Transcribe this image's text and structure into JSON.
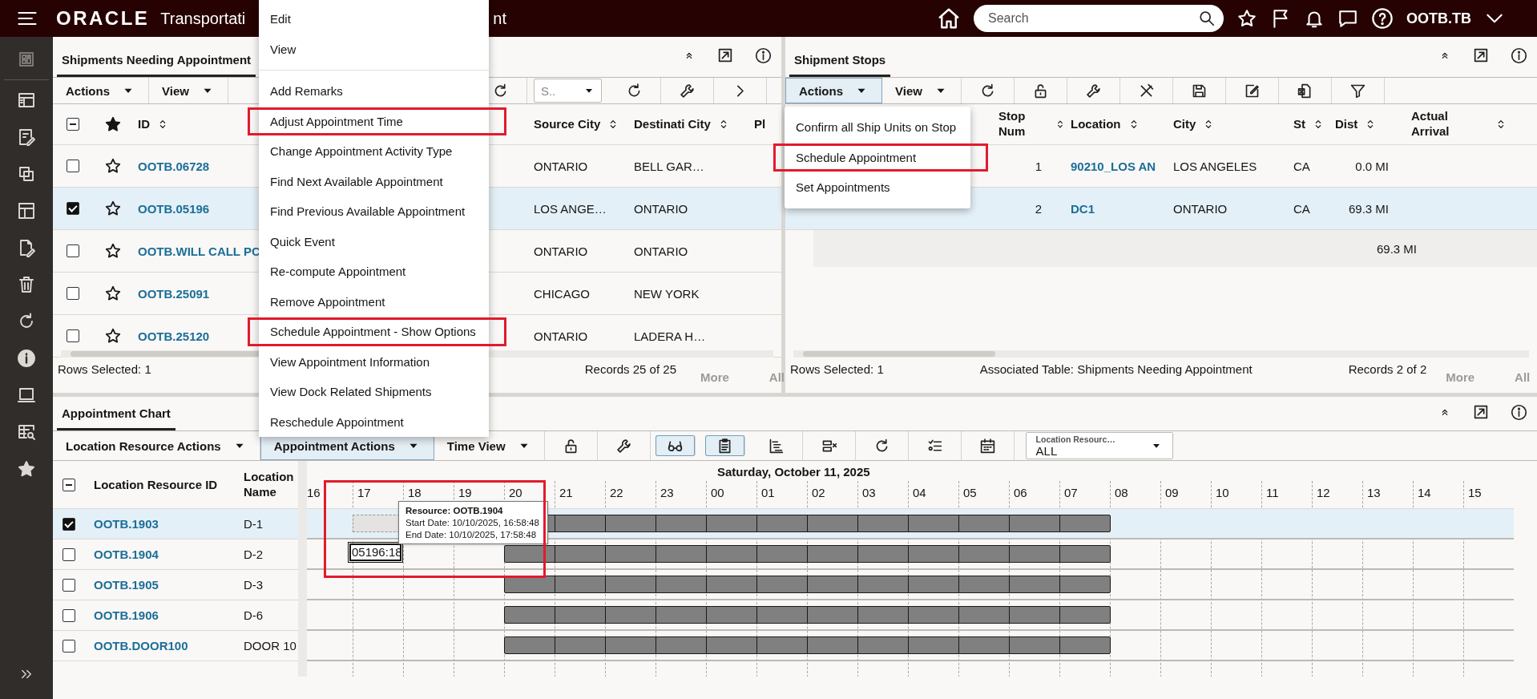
{
  "top_bar": {
    "logo": "ORACLE",
    "title": "Transportati",
    "title_tail": "nt",
    "search": {
      "placeholder": "Search"
    },
    "user": "OOTB.TB"
  },
  "shipments": {
    "title": "Shipments Needing Appointment",
    "toolbar": {
      "actions": {
        "label": "Actions",
        "open": false
      },
      "view": "View",
      "tools": [
        {
          "kind": "refresh"
        }
      ],
      "select": {
        "placeholder": "S.."
      },
      "tools_end": [
        {
          "kind": "reload"
        },
        {
          "kind": "wrench"
        },
        {
          "kind": "more"
        }
      ]
    },
    "select_all_partial": true,
    "columns": [
      {
        "label": "ID",
        "sort_icon": true
      },
      {
        "label": "Source City",
        "sort_icon": true
      },
      {
        "label": "Destinati City",
        "sort_icon": true
      },
      {
        "label": "Pl",
        "sort_icon": false
      }
    ],
    "rows": [
      {
        "id": "OOTB.06728",
        "source_city": "ONTARIO",
        "destination_city": "BELL GAR…",
        "checked": false,
        "selected": false
      },
      {
        "id": "OOTB.05196",
        "source_city": "LOS ANGE…",
        "destination_city": "ONTARIO",
        "checked": true,
        "selected": true
      },
      {
        "id": "OOTB.WILL CALL PC",
        "source_city": "ONTARIO",
        "destination_city": "ONTARIO",
        "checked": false,
        "selected": false
      },
      {
        "id": "OOTB.25091",
        "source_city": "CHICAGO",
        "destination_city": "NEW YORK",
        "checked": false,
        "selected": false
      },
      {
        "id": "OOTB.25120",
        "source_city": "ONTARIO",
        "destination_city": "LADERA H…",
        "checked": false,
        "selected": false
      }
    ],
    "rows_selected": "Rows Selected: 1",
    "records": "Records 25 of 25",
    "more": {
      "label": "More",
      "disabled": true
    },
    "all": {
      "label": "All",
      "disabled": true
    }
  },
  "stops": {
    "title": "Shipment Stops",
    "toolbar": {
      "actions": {
        "label": "Actions",
        "open": true
      },
      "view": "View",
      "tools": [
        {
          "kind": "refresh"
        },
        {
          "kind": "unlock"
        },
        {
          "kind": "wrench"
        },
        {
          "kind": "tools-cross"
        },
        {
          "kind": "save"
        },
        {
          "kind": "edit"
        },
        {
          "kind": "export"
        },
        {
          "kind": "filter"
        }
      ]
    },
    "columns": [
      {
        "label": "Stop Num",
        "sort_icon": true
      },
      {
        "label": "Location",
        "sort_icon": true
      },
      {
        "label": "City",
        "sort_icon": true
      },
      {
        "label": "St",
        "sort_icon": true
      },
      {
        "label": "Dist",
        "sort_icon": true
      },
      {
        "label": "Actual Arrival",
        "sort_icon": true
      }
    ],
    "rows": [
      {
        "stop_num": "1",
        "location": "90210_LOS AN",
        "city": "LOS ANGELES",
        "state": "CA",
        "dist": "0.0 MI",
        "selected": false
      },
      {
        "stop_num": "2",
        "location": "DC1",
        "city": "ONTARIO",
        "state": "CA",
        "dist": "69.3 MI",
        "selected": true
      }
    ],
    "total_dist": "69.3 MI",
    "rows_selected": "Rows Selected: 1",
    "associated": "Associated Table: Shipments Needing Appointment",
    "records": "Records 2 of 2",
    "more": {
      "label": "More",
      "disabled": true
    },
    "all": {
      "label": "All",
      "disabled": true
    }
  },
  "chart": {
    "title": "Appointment Chart",
    "toolbar": {
      "resource_actions": "Location Resource Actions",
      "appointment_actions": {
        "label": "Appointment Actions",
        "open": true
      },
      "time_view": "Time View",
      "tools": [
        {
          "kind": "unlock",
          "pressed": false
        },
        {
          "kind": "wrench",
          "pressed": false
        },
        {
          "kind": "glasses",
          "pressed": true
        },
        {
          "kind": "details",
          "pressed": true
        },
        {
          "kind": "gantt",
          "pressed": false
        },
        {
          "kind": "remove-column",
          "pressed": false
        },
        {
          "kind": "refresh",
          "pressed": false
        },
        {
          "kind": "list",
          "pressed": false
        },
        {
          "kind": "calendar",
          "pressed": false
        }
      ],
      "filter": {
        "label": "Location Resourc…",
        "value": "ALL"
      }
    },
    "select_all_partial": true,
    "columns": [
      "Location Resource ID",
      "Location Name"
    ],
    "hours": [
      {
        "label": "16"
      },
      {
        "label": "17"
      },
      {
        "label": "18"
      },
      {
        "label": "19"
      },
      {
        "label": "20"
      },
      {
        "label": "21"
      },
      {
        "label": "22"
      },
      {
        "label": "23"
      },
      {
        "label": "00",
        "date": "Saturday, October 11, 2025"
      },
      {
        "label": "01"
      },
      {
        "label": "02"
      },
      {
        "label": "03"
      },
      {
        "label": "04"
      },
      {
        "label": "05"
      },
      {
        "label": "06"
      },
      {
        "label": "07"
      },
      {
        "label": "08"
      },
      {
        "label": "09"
      },
      {
        "label": "10"
      },
      {
        "label": "11"
      },
      {
        "label": "12"
      },
      {
        "label": "13"
      },
      {
        "label": "14"
      },
      {
        "label": "15"
      }
    ],
    "rows": [
      {
        "id": "OOTB.1903",
        "name": "D-1",
        "checked": true,
        "selected": true,
        "slots": [
          {
            "kind": "none"
          },
          {
            "kind": "ghost"
          },
          {
            "kind": "none"
          },
          {
            "kind": "none"
          },
          {
            "kind": "bar"
          },
          {
            "kind": "bar"
          },
          {
            "kind": "bar"
          },
          {
            "kind": "bar"
          },
          {
            "kind": "bar"
          },
          {
            "kind": "bar"
          },
          {
            "kind": "bar"
          },
          {
            "kind": "bar"
          },
          {
            "kind": "bar"
          },
          {
            "kind": "bar"
          },
          {
            "kind": "bar"
          },
          {
            "kind": "bar"
          },
          {
            "kind": "none"
          },
          {
            "kind": "none"
          },
          {
            "kind": "none"
          },
          {
            "kind": "none"
          },
          {
            "kind": "none"
          },
          {
            "kind": "none"
          },
          {
            "kind": "none"
          },
          {
            "kind": "none"
          }
        ]
      },
      {
        "id": "OOTB.1904",
        "name": "D-2",
        "checked": false,
        "selected": false,
        "slots": [
          {
            "kind": "none"
          },
          {
            "kind": "dragged",
            "label": "05196:18"
          },
          {
            "kind": "none"
          },
          {
            "kind": "none"
          },
          {
            "kind": "bar"
          },
          {
            "kind": "bar"
          },
          {
            "kind": "bar"
          },
          {
            "kind": "bar"
          },
          {
            "kind": "bar"
          },
          {
            "kind": "bar"
          },
          {
            "kind": "bar"
          },
          {
            "kind": "bar"
          },
          {
            "kind": "bar"
          },
          {
            "kind": "bar"
          },
          {
            "kind": "bar"
          },
          {
            "kind": "bar"
          },
          {
            "kind": "none"
          },
          {
            "kind": "none"
          },
          {
            "kind": "none"
          },
          {
            "kind": "none"
          },
          {
            "kind": "none"
          },
          {
            "kind": "none"
          },
          {
            "kind": "none"
          },
          {
            "kind": "none"
          }
        ]
      },
      {
        "id": "OOTB.1905",
        "name": "D-3",
        "checked": false,
        "selected": false,
        "slots": [
          {
            "kind": "none"
          },
          {
            "kind": "none"
          },
          {
            "kind": "none"
          },
          {
            "kind": "none"
          },
          {
            "kind": "bar"
          },
          {
            "kind": "bar"
          },
          {
            "kind": "bar"
          },
          {
            "kind": "bar"
          },
          {
            "kind": "bar"
          },
          {
            "kind": "bar"
          },
          {
            "kind": "bar"
          },
          {
            "kind": "bar"
          },
          {
            "kind": "bar"
          },
          {
            "kind": "bar"
          },
          {
            "kind": "bar"
          },
          {
            "kind": "bar"
          },
          {
            "kind": "none"
          },
          {
            "kind": "none"
          },
          {
            "kind": "none"
          },
          {
            "kind": "none"
          },
          {
            "kind": "none"
          },
          {
            "kind": "none"
          },
          {
            "kind": "none"
          },
          {
            "kind": "none"
          }
        ]
      },
      {
        "id": "OOTB.1906",
        "name": "D-6",
        "checked": false,
        "selected": false,
        "slots": [
          {
            "kind": "none"
          },
          {
            "kind": "none"
          },
          {
            "kind": "none"
          },
          {
            "kind": "none"
          },
          {
            "kind": "bar"
          },
          {
            "kind": "bar"
          },
          {
            "kind": "bar"
          },
          {
            "kind": "bar"
          },
          {
            "kind": "bar"
          },
          {
            "kind": "bar"
          },
          {
            "kind": "bar"
          },
          {
            "kind": "bar"
          },
          {
            "kind": "bar"
          },
          {
            "kind": "bar"
          },
          {
            "kind": "bar"
          },
          {
            "kind": "bar"
          },
          {
            "kind": "none"
          },
          {
            "kind": "none"
          },
          {
            "kind": "none"
          },
          {
            "kind": "none"
          },
          {
            "kind": "none"
          },
          {
            "kind": "none"
          },
          {
            "kind": "none"
          },
          {
            "kind": "none"
          }
        ]
      },
      {
        "id": "OOTB.DOOR100",
        "name": "DOOR 10",
        "checked": false,
        "selected": false,
        "slots": [
          {
            "kind": "none"
          },
          {
            "kind": "none"
          },
          {
            "kind": "none"
          },
          {
            "kind": "none"
          },
          {
            "kind": "bar"
          },
          {
            "kind": "bar"
          },
          {
            "kind": "bar"
          },
          {
            "kind": "bar"
          },
          {
            "kind": "bar"
          },
          {
            "kind": "bar"
          },
          {
            "kind": "bar"
          },
          {
            "kind": "bar"
          },
          {
            "kind": "bar"
          },
          {
            "kind": "bar"
          },
          {
            "kind": "bar"
          },
          {
            "kind": "bar"
          },
          {
            "kind": "none"
          },
          {
            "kind": "none"
          },
          {
            "kind": "none"
          },
          {
            "kind": "none"
          },
          {
            "kind": "none"
          },
          {
            "kind": "none"
          },
          {
            "kind": "none"
          },
          {
            "kind": "none"
          }
        ]
      }
    ],
    "tooltip": {
      "title": "Resource: OOTB.1904",
      "start": "Start Date: 10/10/2025, 16:58:48",
      "end": "End Date: 10/10/2025, 17:58:48"
    },
    "highlighted": true
  },
  "appointment_menu": {
    "groups": [
      [
        {
          "label": "Edit",
          "highlighted": false
        },
        {
          "label": "View",
          "highlighted": false
        }
      ],
      [
        {
          "label": "Add Remarks",
          "highlighted": false
        },
        {
          "label": "Adjust Appointment Time",
          "highlighted": true
        },
        {
          "label": "Change Appointment Activity Type",
          "highlighted": false
        },
        {
          "label": "Find Next Available Appointment",
          "highlighted": false
        },
        {
          "label": "Find Previous Available Appointment",
          "highlighted": false
        },
        {
          "label": "Quick Event",
          "highlighted": false
        },
        {
          "label": "Re-compute Appointment",
          "highlighted": false
        },
        {
          "label": "Remove Appointment",
          "highlighted": false
        },
        {
          "label": "Schedule Appointment - Show Options",
          "highlighted": true
        },
        {
          "label": "View Appointment Information",
          "highlighted": false
        },
        {
          "label": "View Dock Related Shipments",
          "highlighted": false
        },
        {
          "label": "Reschedule Appointment",
          "highlighted": false
        }
      ]
    ]
  },
  "stop_actions_menu": {
    "items": [
      {
        "label": "Confirm all Ship Units on Stop",
        "highlighted": false
      },
      {
        "label": "Schedule Appointment",
        "highlighted": true
      },
      {
        "label": "Set Appointments",
        "highlighted": false
      }
    ]
  }
}
